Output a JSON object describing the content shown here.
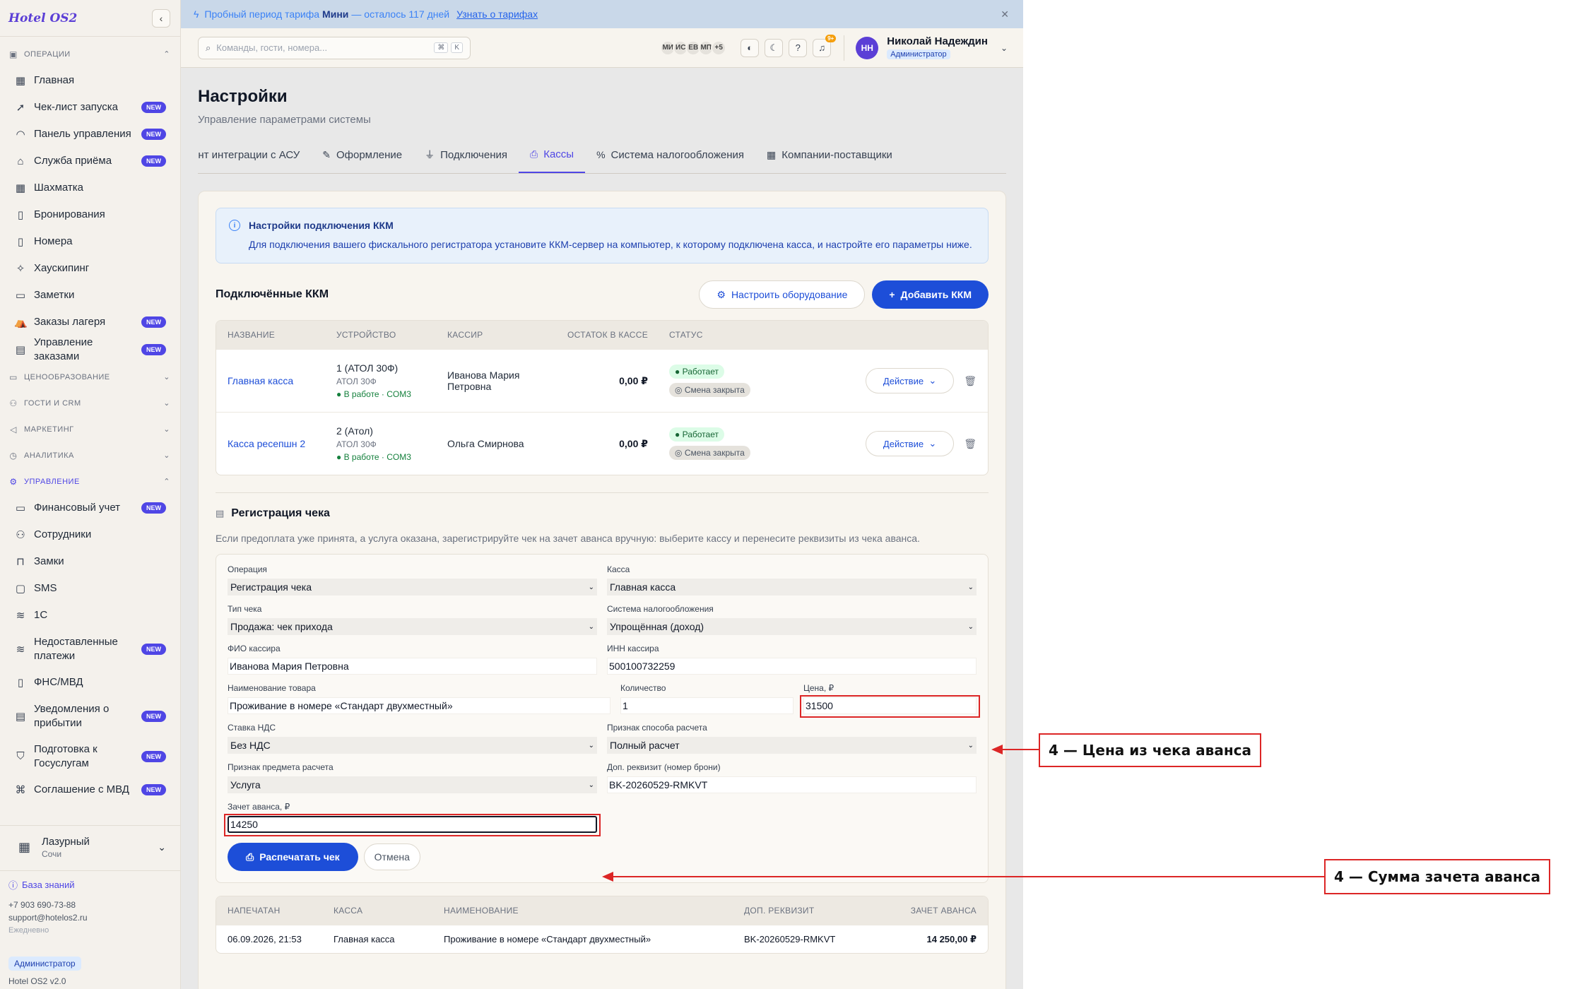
{
  "sidebar": {
    "logo": "Hotel OS2",
    "sections": {
      "operations": "ОПЕРАЦИИ",
      "pricing": "ЦЕНООБРАЗОВАНИЕ",
      "guests": "ГОСТИ И CRM",
      "marketing": "МАРКЕТИНГ",
      "analytics": "АНАЛИТИКА",
      "management": "УПРАВЛЕНИЕ"
    },
    "items": [
      {
        "label": "Главная",
        "icon": "grid-icon",
        "new": false
      },
      {
        "label": "Чек-лист запуска",
        "icon": "rocket-icon",
        "new": true
      },
      {
        "label": "Панель управления",
        "icon": "gauge-icon",
        "new": true
      },
      {
        "label": "Служба приёма",
        "icon": "bell-desk-icon",
        "new": true
      },
      {
        "label": "Шахматка",
        "icon": "table-icon",
        "new": false
      },
      {
        "label": "Бронирования",
        "icon": "clipboard-icon",
        "new": false
      },
      {
        "label": "Номера",
        "icon": "door-icon",
        "new": false
      },
      {
        "label": "Хаускипинг",
        "icon": "sparkle-icon",
        "new": false
      },
      {
        "label": "Заметки",
        "icon": "note-icon",
        "new": false
      },
      {
        "label": "Заказы лагеря",
        "icon": "tent-icon",
        "new": true
      },
      {
        "label": "Управление заказами",
        "icon": "receipt-icon",
        "new": true
      }
    ],
    "mgmt_items": [
      {
        "label": "Финансовый учет",
        "icon": "wallet-icon",
        "new": true
      },
      {
        "label": "Сотрудники",
        "icon": "user-icon",
        "new": false
      },
      {
        "label": "Замки",
        "icon": "lock-icon",
        "new": false
      },
      {
        "label": "SMS",
        "icon": "message-icon",
        "new": false
      },
      {
        "label": "1C",
        "icon": "database-icon",
        "new": false
      },
      {
        "label": "Недоставленные платежи",
        "icon": "database-icon",
        "new": true
      },
      {
        "label": "ФНС/МВД",
        "icon": "file-icon",
        "new": false
      },
      {
        "label": "Уведомления о прибытии",
        "icon": "file-text-icon",
        "new": true
      },
      {
        "label": "Подготовка к Госуслугам",
        "icon": "shield-icon",
        "new": true
      },
      {
        "label": "Соглашение с МВД",
        "icon": "handshake-icon",
        "new": true
      }
    ],
    "new_badge": "NEW",
    "hotel": {
      "name": "Лазурный",
      "city": "Сочи"
    },
    "knowledge_base": "База знаний",
    "phone": "+7 903 690-73-88",
    "email": "support@hotelos2.ru",
    "hours": "Ежедневно",
    "role": "Администратор",
    "version": "Hotel OS2 v2.0"
  },
  "trial": {
    "prefix": "Пробный период тарифа",
    "plan": "Мини",
    "suffix": "— осталось 117 дней",
    "link": "Узнать о тарифах"
  },
  "topbar": {
    "search_placeholder": "Команды, гости, номера...",
    "kbd": [
      "⌘",
      "K"
    ],
    "avatars": [
      "МИ",
      "ИС",
      "ЕВ",
      "МП",
      "+5"
    ],
    "notif_count": "9+",
    "user": {
      "initials": "НН",
      "name": "Николай Надеждин",
      "role": "Администратор"
    }
  },
  "page": {
    "title": "Настройки",
    "subtitle": "Управление параметрами системы",
    "tabs": [
      {
        "label": "ент интеграции с АСУ",
        "icon": "",
        "active": false
      },
      {
        "label": "Оформление",
        "icon": "pen-icon",
        "active": false
      },
      {
        "label": "Подключения",
        "icon": "plug-icon",
        "active": false
      },
      {
        "label": "Кассы",
        "icon": "printer-icon",
        "active": true
      },
      {
        "label": "Система налогообложения",
        "icon": "percent-icon",
        "active": false
      },
      {
        "label": "Компании-поставщики",
        "icon": "building-icon",
        "active": false
      }
    ]
  },
  "alert": {
    "title": "Настройки подключения ККМ",
    "body": "Для подключения вашего фискального регистратора установите ККМ-сервер на компьютер, к которому подключена касса, и настройте его параметры ниже."
  },
  "kkm": {
    "title": "Подключённые ККМ",
    "configure_btn": "Настроить оборудование",
    "add_btn": "Добавить ККМ",
    "columns": [
      "НАЗВАНИЕ",
      "УСТРОЙСТВО",
      "КАССИР",
      "ОСТАТОК В КАССЕ",
      "СТАТУС"
    ],
    "rows": [
      {
        "name": "Главная касса",
        "device": "1 (АТОЛ 30Ф)",
        "model": "АТОЛ 30Ф",
        "conn": "В работе · COM3",
        "cashier": "Иванова Мария Петровна",
        "balance": "0,00 ₽",
        "status": "Работает",
        "shift": "Смена закрыта",
        "action": "Действие"
      },
      {
        "name": "Касса ресепшн 2",
        "device": "2 (Атол)",
        "model": "АТОЛ 30Ф",
        "conn": "В работе · COM3",
        "cashier": "Ольга Смирнова",
        "balance": "0,00 ₽",
        "status": "Работает",
        "shift": "Смена закрыта",
        "action": "Действие"
      }
    ]
  },
  "receipt": {
    "title": "Регистрация чека",
    "desc": "Если предоплата уже принята, а услуга оказана, зарегистрируйте чек на зачет аванса вручную: выберите кассу и перенесите реквизиты из чека аванса.",
    "fields": {
      "operation": {
        "label": "Операция",
        "value": "Регистрация чека"
      },
      "register": {
        "label": "Касса",
        "value": "Главная касса"
      },
      "type": {
        "label": "Тип чека",
        "value": "Продажа: чек прихода"
      },
      "tax": {
        "label": "Система налогообложения",
        "value": "Упрощённая (доход)"
      },
      "cashier": {
        "label": "ФИО кассира",
        "value": "Иванова Мария Петровна"
      },
      "inn": {
        "label": "ИНН кассира",
        "value": "500100732259"
      },
      "product": {
        "label": "Наименование товара",
        "value": "Проживание в номере «Стандарт двухместный»"
      },
      "qty": {
        "label": "Количество",
        "value": "1"
      },
      "price": {
        "label": "Цена, ₽",
        "value": "31500"
      },
      "vat": {
        "label": "Ставка НДС",
        "value": "Без НДС"
      },
      "payment_method": {
        "label": "Признак способа расчета",
        "value": "Полный расчет"
      },
      "subject": {
        "label": "Признак предмета расчета",
        "value": "Услуга"
      },
      "extra": {
        "label": "Доп. реквизит (номер брони)",
        "value": "BK-20260529-RMKVT"
      },
      "advance": {
        "label": "Зачет аванса, ₽",
        "value": "14250"
      }
    },
    "print_btn": "Распечатать чек",
    "cancel_btn": "Отмена"
  },
  "history": {
    "columns": [
      "НАПЕЧАТАН",
      "КАССА",
      "НАИМЕНОВАНИЕ",
      "ДОП. РЕКВИЗИТ",
      "ЗАЧЕТ АВАНСА"
    ],
    "row": [
      "06.09.2026, 21:53",
      "Главная касса",
      "Проживание в номере «Стандарт двухместный»",
      "BK-20260529-RMKVT",
      "14 250,00 ₽"
    ]
  },
  "annotations": {
    "price": "4 — Цена из чека аванса",
    "advance": "4 — Сумма зачета аванса"
  }
}
